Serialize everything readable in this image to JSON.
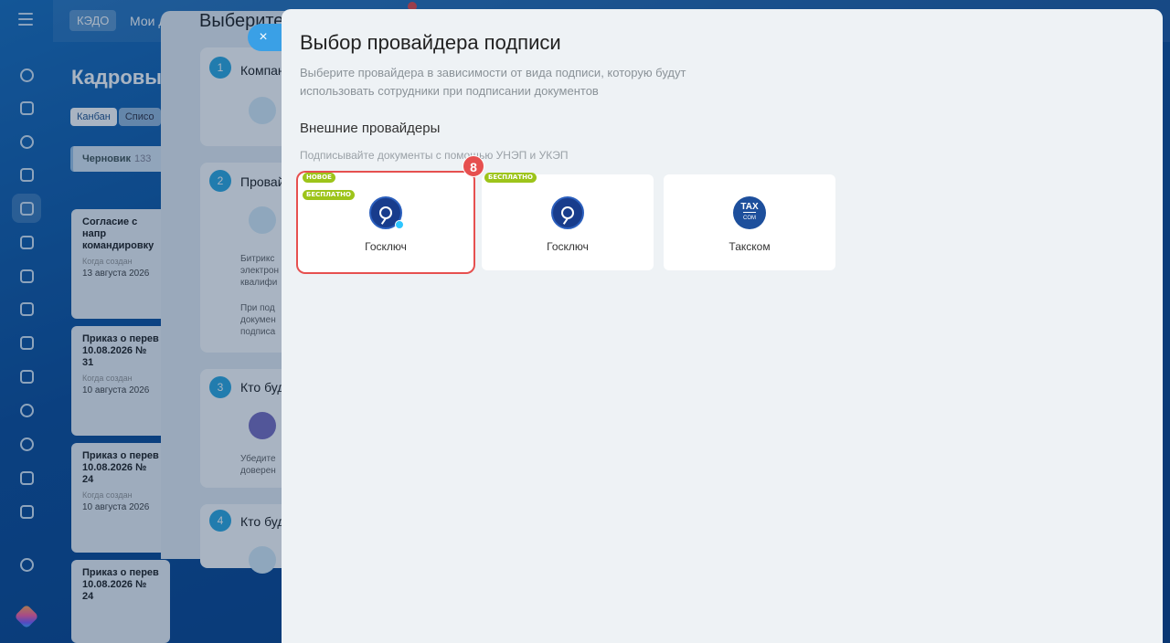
{
  "colors": {
    "accent": "#2fa9e0",
    "highlight": "#e6504f",
    "badge": "#9dc41a",
    "logo_blue": "#183c8c"
  },
  "rail": {
    "icons": [
      "menu-icon",
      "pulse-icon",
      "chat-icon",
      "tasks-icon",
      "document-icon",
      "sign-icon",
      "calendar-icon",
      "contacts-icon",
      "file-icon",
      "card-icon",
      "mail-icon",
      "shield-icon",
      "location-icon",
      "list-icon",
      "check-icon",
      "settings-icon",
      "copilot-icon"
    ]
  },
  "background": {
    "top_chip": "КЭДО",
    "top_tab": "Мои д",
    "page_title": "Кадровые",
    "view_tabs": [
      "Канбан",
      "Списо"
    ],
    "column": {
      "name": "Черновик",
      "count": "133"
    },
    "cards": [
      {
        "title": "Согласие с напр командировку",
        "label": "Когда создан",
        "date": "13 августа 2026"
      },
      {
        "title": "Приказ о перев 10.08.2026 № 31",
        "label": "Когда создан",
        "date": "10 августа 2026"
      },
      {
        "title": "Приказ о перев 10.08.2026 № 24",
        "label": "Когда создан",
        "date": "10 августа 2026"
      },
      {
        "title": "Приказ о перев 10.08.2026 № 24",
        "label": "",
        "date": ""
      }
    ],
    "steps_title": "Выберите",
    "steps": [
      {
        "num": "1",
        "label": "Компан"
      },
      {
        "num": "2",
        "label": "Провай"
      },
      {
        "num": "3",
        "label": "Кто буд"
      },
      {
        "num": "4",
        "label": "Кто буд"
      }
    ],
    "step_texts": [
      "Битрикс",
      "электрон",
      "квалифи",
      "При под",
      "докумен",
      "подписа",
      "Убедите",
      "доверен"
    ],
    "close_label": "×"
  },
  "slider": {
    "title": "Выбор провайдера подписи",
    "subtitle": "Выберите провайдера в зависимости от вида подписи, которую будут использовать сотрудники при подписании документов",
    "section_title": "Внешние провайдеры",
    "section_hint": "Подписывайте документы с помощью УНЭП и УКЭП",
    "step_marker": "8",
    "providers": [
      {
        "name": "Госключ",
        "badges": [
          "НОВОЕ",
          "БЕСПЛАТНО"
        ],
        "icon": "goskey-bolt-icon",
        "selected": true
      },
      {
        "name": "Госключ",
        "badges": [
          "БЕСПЛАТНО"
        ],
        "icon": "goskey-icon",
        "selected": false
      },
      {
        "name": "Такском",
        "badges": [],
        "icon": "taxcom-icon",
        "selected": false,
        "logo_text": "TAX",
        "logo_sub": "COM"
      }
    ]
  }
}
